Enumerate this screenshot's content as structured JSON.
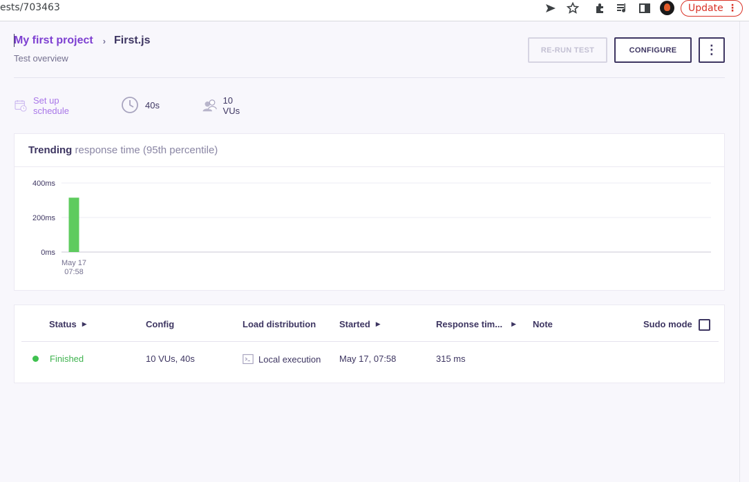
{
  "browser": {
    "url": "ests/703463",
    "update_label": "Update",
    "icons": [
      "send-icon",
      "star-icon",
      "extensions-icon",
      "media-icon",
      "sidepanel-icon",
      "profile-avatar",
      "more-icon"
    ]
  },
  "header": {
    "project": "My first project",
    "separator": "›",
    "test_name": "First.js",
    "subtitle": "Test overview",
    "rerun_label": "RE-RUN TEST",
    "configure_label": "CONFIGURE",
    "more_label": "⋮"
  },
  "info": {
    "schedule_label": "Set up schedule",
    "duration": "40s",
    "vus": "10 VUs"
  },
  "chart": {
    "title_strong": "Trending",
    "title_muted": " response time (95th percentile)"
  },
  "chart_data": {
    "type": "bar",
    "categories": [
      "May 17\n07:58"
    ],
    "values": [
      315
    ],
    "ylim": [
      0,
      400
    ],
    "yticks": [
      "0ms",
      "200ms",
      "400ms"
    ],
    "ytick_values": [
      0,
      200,
      400
    ],
    "grid": true,
    "bar_color": "#5ecb5e"
  },
  "table": {
    "headers": {
      "status": "Status",
      "config": "Config",
      "load": "Load distribution",
      "started": "Started",
      "response": "Response tim...",
      "note": "Note",
      "sudo": "Sudo mode"
    },
    "rows": [
      {
        "status": "Finished",
        "config": "10 VUs, 40s",
        "load": "Local execution",
        "started": "May 17, 07:58",
        "response": "315 ms",
        "note": ""
      }
    ]
  },
  "colors": {
    "accent": "#7d3fd1",
    "text": "#3d3561",
    "success": "#3fc14f",
    "update": "#d93025"
  }
}
